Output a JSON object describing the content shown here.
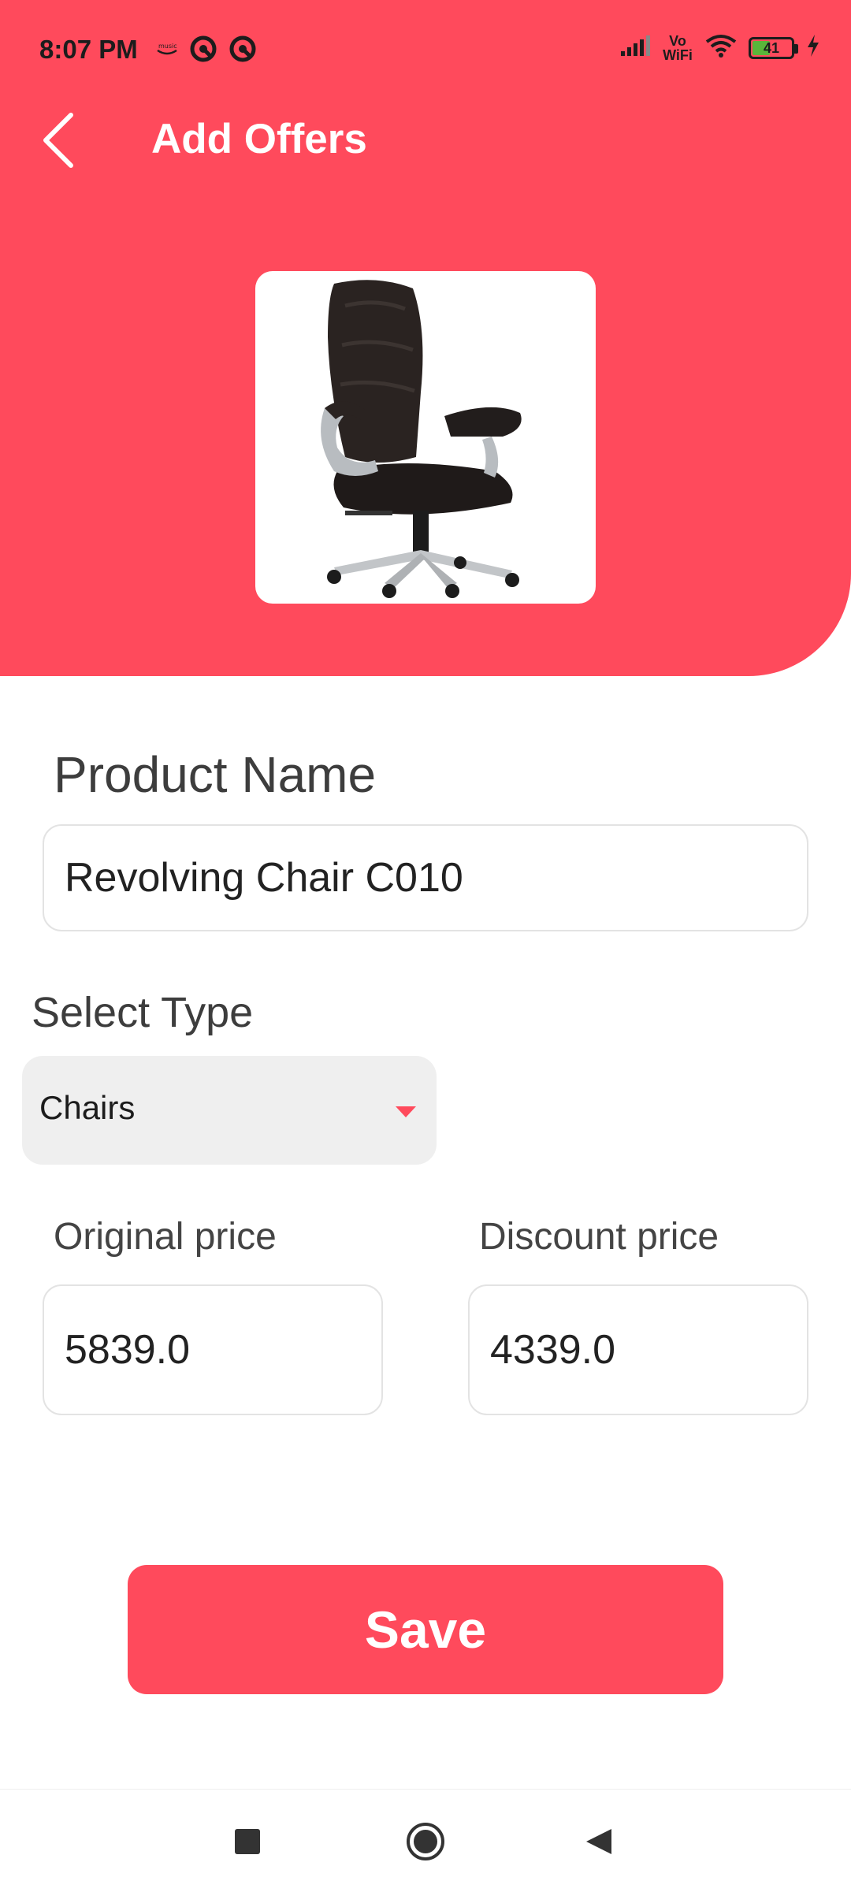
{
  "status": {
    "time": "8:07 PM",
    "volte_line1": "Vo",
    "volte_line2": "WiFi",
    "battery": "41",
    "icons": [
      "amazon-music-icon",
      "app-notification-icon",
      "app-notification-icon",
      "signal-icon",
      "vowifi-icon",
      "wifi-icon",
      "battery-icon",
      "charging-icon"
    ]
  },
  "appbar": {
    "title": "Add Offers",
    "back_icon": "chevron-left-icon"
  },
  "product_image": {
    "subject": "black leather revolving office chair"
  },
  "form": {
    "product_name_label": "Product Name",
    "product_name_value": "Revolving Chair C010",
    "select_type_label": "Select Type",
    "select_type_value": "Chairs",
    "original_price_label": "Original price",
    "original_price_value": "5839.0",
    "discount_price_label": "Discount price",
    "discount_price_value": "4339.0"
  },
  "save_label": "Save",
  "navbar": {
    "icons": [
      "recents-square-icon",
      "home-circle-icon",
      "back-triangle-icon"
    ]
  },
  "colors": {
    "accent": "#ff4a5c",
    "dropdown_bg": "#efefef",
    "caret": "#ff4a5c"
  }
}
